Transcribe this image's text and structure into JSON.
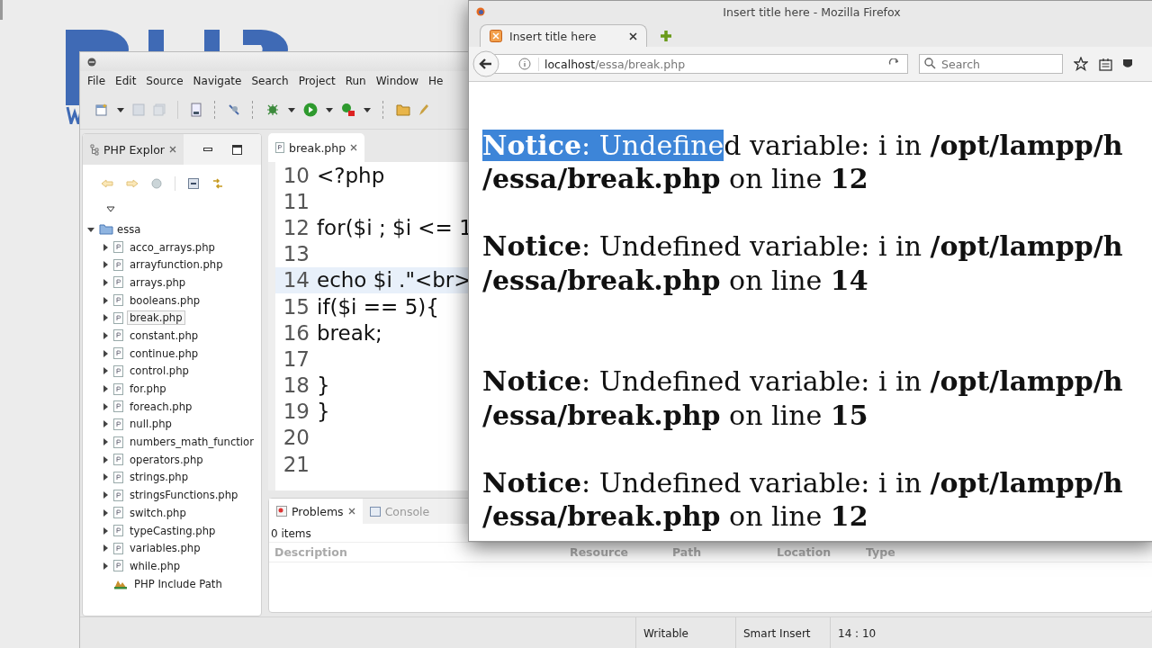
{
  "ide": {
    "menu": [
      "File",
      "Edit",
      "Source",
      "Navigate",
      "Search",
      "Project",
      "Run",
      "Window",
      "He"
    ],
    "explorer": {
      "tab": "PHP Explor",
      "tree": {
        "label": "essa",
        "expanded": true,
        "children": [
          {
            "label": "acco_arrays.php",
            "kind": "file",
            "expanded": false,
            "selected": false
          },
          {
            "label": "arrayfunction.php",
            "kind": "file",
            "expanded": false,
            "selected": false
          },
          {
            "label": "arrays.php",
            "kind": "file",
            "expanded": false,
            "selected": false
          },
          {
            "label": "booleans.php",
            "kind": "file",
            "expanded": false,
            "selected": false
          },
          {
            "label": "break.php",
            "kind": "file",
            "expanded": false,
            "selected": true
          },
          {
            "label": "constant.php",
            "kind": "file",
            "expanded": false,
            "selected": false
          },
          {
            "label": "continue.php",
            "kind": "file",
            "expanded": false,
            "selected": false
          },
          {
            "label": "control.php",
            "kind": "file",
            "expanded": false,
            "selected": false
          },
          {
            "label": "for.php",
            "kind": "file",
            "expanded": false,
            "selected": false
          },
          {
            "label": "foreach.php",
            "kind": "file",
            "expanded": false,
            "selected": false
          },
          {
            "label": "null.php",
            "kind": "file",
            "expanded": false,
            "selected": false
          },
          {
            "label": "numbers_math_functior",
            "kind": "file",
            "expanded": false,
            "selected": false
          },
          {
            "label": "operators.php",
            "kind": "file",
            "expanded": false,
            "selected": false
          },
          {
            "label": "strings.php",
            "kind": "file",
            "expanded": false,
            "selected": false
          },
          {
            "label": "stringsFunctions.php",
            "kind": "file",
            "expanded": false,
            "selected": false
          },
          {
            "label": "switch.php",
            "kind": "file",
            "expanded": false,
            "selected": false
          },
          {
            "label": "typeCasting.php",
            "kind": "file",
            "expanded": false,
            "selected": false
          },
          {
            "label": "variables.php",
            "kind": "file",
            "expanded": false,
            "selected": false
          },
          {
            "label": "while.php",
            "kind": "file",
            "expanded": false,
            "selected": false
          },
          {
            "label": "PHP Include Path",
            "kind": "library",
            "selected": false
          }
        ]
      }
    },
    "editor": {
      "tab": "break.php",
      "lines": [
        {
          "number": "10",
          "code": "<?php",
          "current": false
        },
        {
          "number": "11",
          "current": false
        },
        {
          "number": "12",
          "code": "for($i ; $i <= 1",
          "current": false
        },
        {
          "number": "13",
          "current": false
        },
        {
          "number": "14",
          "code": "echo $i .\"<br>",
          "current": true
        },
        {
          "number": "15",
          "code": "if($i == 5){",
          "current": false
        },
        {
          "number": "16",
          "code": "break;",
          "current": false
        },
        {
          "number": "17",
          "current": false
        },
        {
          "number": "18",
          "code": "}",
          "current": false
        },
        {
          "number": "19",
          "code": "}",
          "current": false
        },
        {
          "number": "20",
          "current": false
        },
        {
          "number": "21",
          "current": false
        }
      ]
    },
    "bottom_panel": {
      "tabs": [
        {
          "label": "Problems",
          "selected": true
        },
        {
          "label": "Console",
          "selected": false
        }
      ],
      "summary": "0 items",
      "columns": [
        "Description",
        "Resource",
        "Path",
        "Location",
        "Type"
      ]
    },
    "status_bar": [
      "Writable",
      "Smart Insert",
      "14 : 10"
    ]
  },
  "browser": {
    "title": "Insert title here - Mozilla Firefox",
    "tab": "Insert title here",
    "url_host": "localhost",
    "url_path": "/essa/break.php",
    "search": {
      "placeholder": "Search"
    },
    "notices": [
      {
        "label": "Notice",
        "selected_text": ": Undefine",
        "message": "d variable: i in ",
        "path": "/opt/lampp/h",
        "file": "/essa/break.php",
        "on_line": " on line ",
        "line": "12",
        "extra_break": false
      },
      {
        "label": "Notice",
        "message": ": Undefined variable: i in ",
        "path": "/opt/lampp/h",
        "file": "/essa/break.php",
        "on_line": " on line ",
        "line": "14",
        "extra_break": false
      },
      {
        "label": "Notice",
        "message": ": Undefined variable: i in ",
        "path": "/opt/lampp/h",
        "file": "/essa/break.php",
        "on_line": " on line ",
        "line": "15",
        "extra_break": true
      },
      {
        "label": "Notice",
        "message": ": Undefined variable: i in ",
        "path": "/opt/lampp/h",
        "file": "/essa/break.php",
        "on_line": " on line ",
        "line": "12",
        "extra_break": false
      }
    ]
  }
}
